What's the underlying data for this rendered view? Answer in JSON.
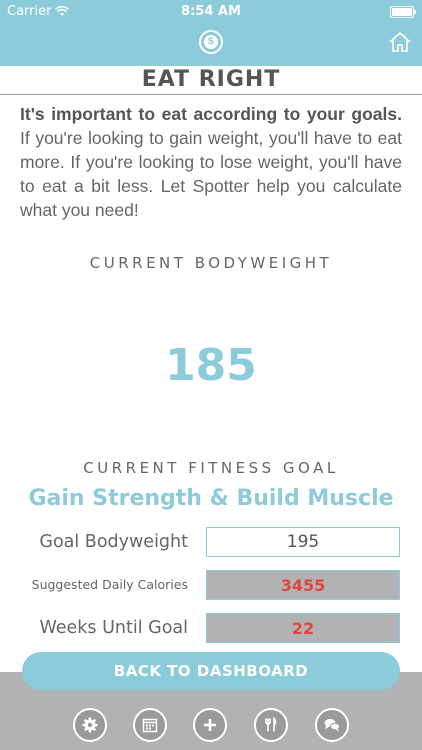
{
  "status": {
    "carrier": "Carrier",
    "time": "8:54 AM"
  },
  "header": {
    "logo_letter": "S"
  },
  "page": {
    "title": "EAT RIGHT"
  },
  "intro": {
    "bold": "It's important to eat according to your goals.",
    "rest": " If you're looking to gain weight, you'll have to eat more. If you're looking to lose weight, you'll have to eat a bit less. Let Spotter help you calculate what you need!"
  },
  "bodyweight": {
    "label": "CURRENT BODYWEIGHT",
    "value": "185"
  },
  "goal": {
    "label": "CURRENT FITNESS GOAL",
    "name": "Gain Strength & Build Muscle"
  },
  "rows": {
    "goal_bodyweight": {
      "label": "Goal Bodyweight",
      "value": "195"
    },
    "calories": {
      "label": "Suggested Daily Calories",
      "value": "3455"
    },
    "weeks": {
      "label": "Weeks Until Goal",
      "value": "22"
    }
  },
  "actions": {
    "back_label": "BACK TO DASHBOARD"
  },
  "nav": [
    "settings-icon",
    "calendar-icon",
    "add-icon",
    "nutrition-icon",
    "chat-icon"
  ],
  "colors": {
    "accent": "#8ccbd9",
    "footer": "#b1b2b4",
    "value_red": "#e0463e"
  }
}
